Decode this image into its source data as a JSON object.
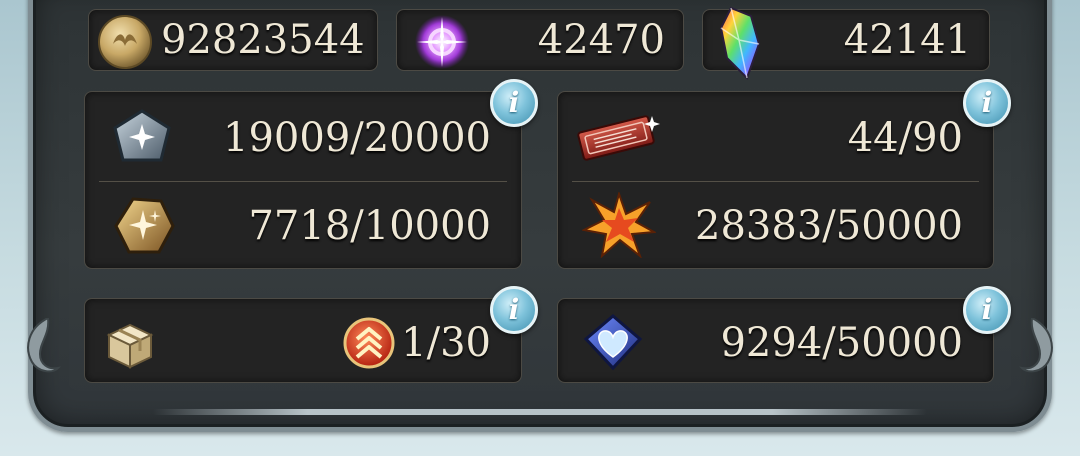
{
  "currencies": {
    "rupie": "92823544",
    "crystal_piece": "42470",
    "crystal": "42141"
  },
  "panel_left": {
    "row1_value": "19009/20000",
    "row2_value": "7718/10000"
  },
  "panel_right": {
    "row1_value": "44/90",
    "row2_value": "28383/50000"
  },
  "panel_bottom_left": {
    "value": "1/30"
  },
  "panel_bottom_right": {
    "value": "9294/50000"
  },
  "info_label": "i"
}
